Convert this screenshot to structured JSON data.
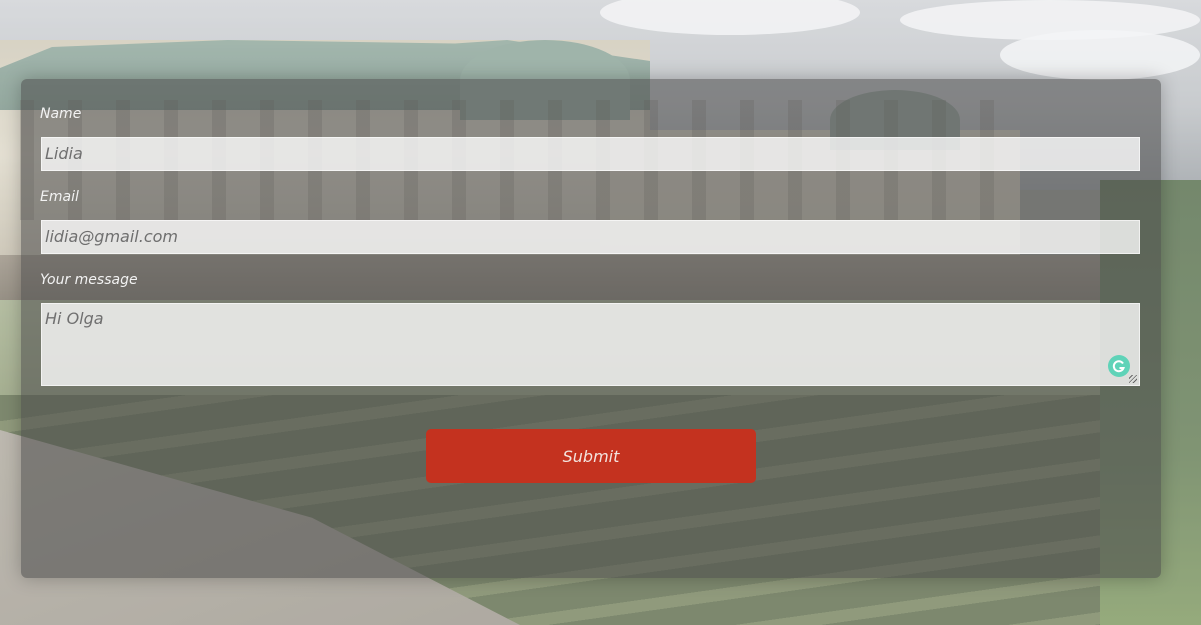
{
  "form": {
    "name_label": "Name",
    "name_value": "Lidia",
    "email_label": "Email",
    "email_value": "lidia@gmail.com",
    "message_label": "Your message",
    "message_value": "Hi Olga",
    "submit_label": "Submit"
  },
  "icons": {
    "grammar_icon": "grammarly-icon",
    "resize_icon": "resize-handle-icon"
  },
  "colors": {
    "submit_background": "#c4321f",
    "card_overlay": "rgba(72,72,72,0.55)",
    "grammar_icon": "#5fd3b8"
  }
}
